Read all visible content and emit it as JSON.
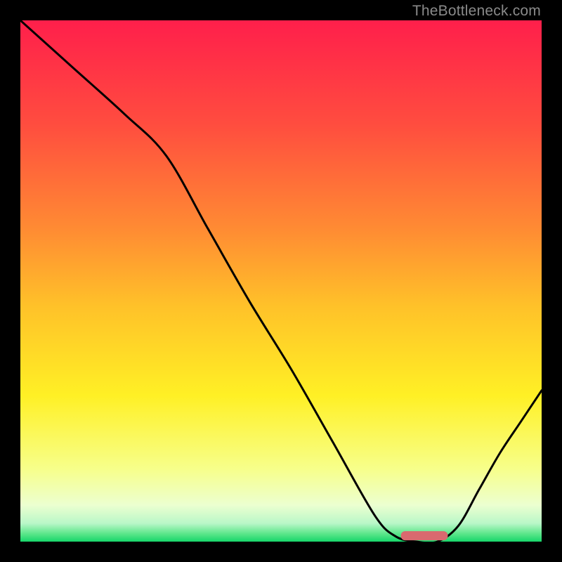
{
  "watermark": "TheBottleneck.com",
  "chart_data": {
    "type": "line",
    "title": "",
    "xlabel": "",
    "ylabel": "",
    "x_range": [
      0,
      100
    ],
    "y_range": [
      0,
      100
    ],
    "curve": {
      "name": "bottleneck-curve",
      "x": [
        0,
        10,
        20,
        28,
        36,
        44,
        52,
        60,
        68,
        72,
        76,
        80,
        84,
        88,
        92,
        96,
        100
      ],
      "y": [
        100,
        91,
        82,
        74,
        60,
        46,
        33,
        19,
        5,
        1,
        0,
        0,
        3,
        10,
        17,
        23,
        29
      ]
    },
    "marker": {
      "name": "optimal-zone",
      "x_start": 73,
      "x_end": 82,
      "y": 1.2,
      "color": "#d9696f"
    },
    "gradient_stops": [
      {
        "pos": 0.0,
        "color": "#ff1f4b"
      },
      {
        "pos": 0.2,
        "color": "#ff4d3f"
      },
      {
        "pos": 0.4,
        "color": "#ff8b33"
      },
      {
        "pos": 0.55,
        "color": "#ffc229"
      },
      {
        "pos": 0.72,
        "color": "#fff025"
      },
      {
        "pos": 0.86,
        "color": "#f7ff8a"
      },
      {
        "pos": 0.93,
        "color": "#ecffd0"
      },
      {
        "pos": 0.965,
        "color": "#b9f7c8"
      },
      {
        "pos": 0.985,
        "color": "#5be68a"
      },
      {
        "pos": 1.0,
        "color": "#17d66a"
      }
    ]
  }
}
